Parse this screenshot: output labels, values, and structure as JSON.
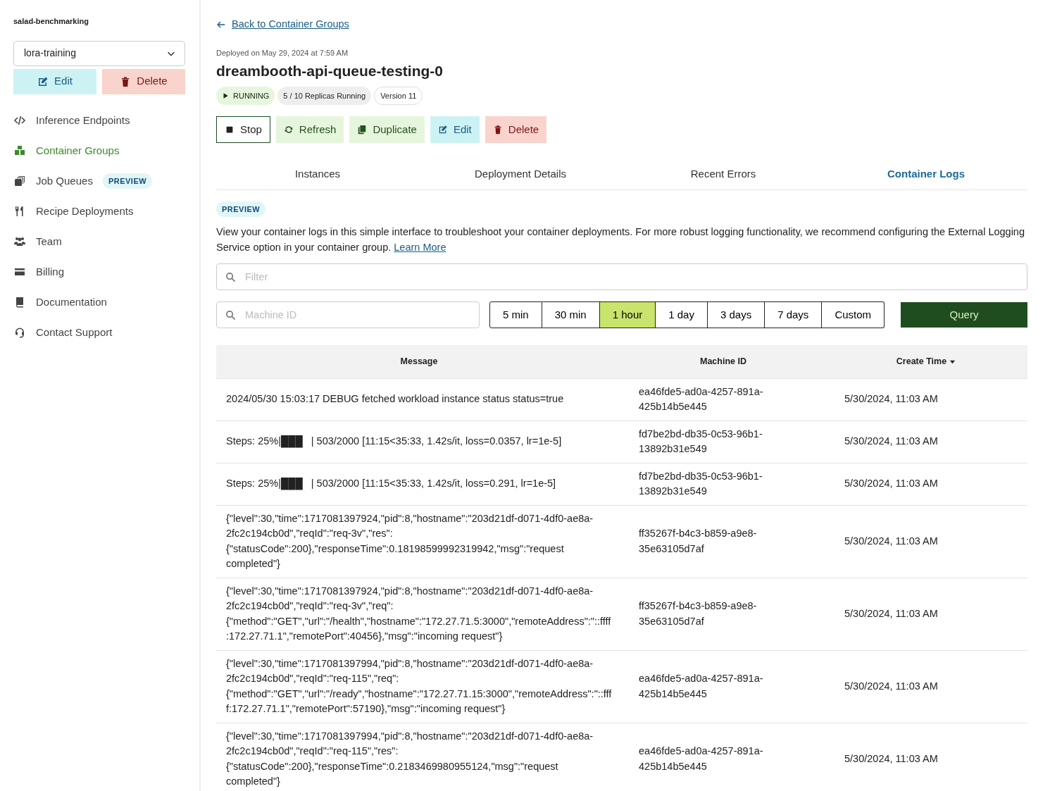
{
  "sidebar": {
    "org": "salad-benchmarking",
    "project_select": {
      "value": "lora-training"
    },
    "buttons": [
      {
        "label": "Edit",
        "kind": "edit"
      },
      {
        "label": "Delete",
        "kind": "delete"
      }
    ],
    "nav": [
      {
        "label": "Inference Endpoints",
        "kind": "code",
        "selected": false
      },
      {
        "label": "Container Groups",
        "kind": "containers",
        "selected": true
      },
      {
        "label": "Job Queues",
        "kind": "queue",
        "selected": false,
        "badge": "PREVIEW"
      },
      {
        "label": "Recipe Deployments",
        "kind": "recipe",
        "selected": false
      },
      {
        "label": "Team",
        "kind": "team",
        "selected": false
      },
      {
        "label": "Billing",
        "kind": "billing",
        "selected": false
      },
      {
        "label": "Documentation",
        "kind": "book",
        "selected": false
      },
      {
        "label": "Contact Support",
        "kind": "support",
        "selected": false
      }
    ]
  },
  "back_link": "Back to Container Groups",
  "deployed": "Deployed on May 29, 2024 at 7:59 AM",
  "title": "dreambooth-api-queue-testing-0",
  "badges": [
    {
      "label": "RUNNING",
      "kind": "status"
    },
    {
      "label": "5 / 10 Replicas Running",
      "kind": "replicas"
    },
    {
      "label": "Version 11",
      "kind": "version"
    }
  ],
  "actions": [
    {
      "label": "Stop",
      "kind": "stop"
    },
    {
      "label": "Refresh",
      "kind": "refresh"
    },
    {
      "label": "Duplicate",
      "kind": "duplicate"
    },
    {
      "label": "Edit",
      "kind": "edit"
    },
    {
      "label": "Delete",
      "kind": "delete"
    }
  ],
  "tabs": [
    {
      "label": "Instances",
      "selected": false
    },
    {
      "label": "Deployment Details",
      "selected": false
    },
    {
      "label": "Recent Errors",
      "selected": false
    },
    {
      "label": "Container Logs",
      "selected": true
    }
  ],
  "preview_badge": "PREVIEW",
  "description": {
    "text": "View your container logs in this simple interface to troubleshoot your container deployments. For more robust logging functionality, we recommend configuring the External Logging Service option in your container group.",
    "link": "Learn More"
  },
  "filter": {
    "placeholder": "Filter"
  },
  "machine_filter": {
    "placeholder": "Machine ID"
  },
  "ranges": [
    {
      "label": "5 min",
      "selected": false
    },
    {
      "label": "30 min",
      "selected": false
    },
    {
      "label": "1 hour",
      "selected": true
    },
    {
      "label": "1 day",
      "selected": false
    },
    {
      "label": "3 days",
      "selected": false
    },
    {
      "label": "7 days",
      "selected": false
    },
    {
      "label": "Custom",
      "selected": false
    }
  ],
  "query_button": "Query",
  "table": {
    "columns": [
      {
        "label": "Message",
        "sorted": false
      },
      {
        "label": "Machine ID",
        "sorted": false
      },
      {
        "label": "Create Time",
        "sorted": true
      }
    ],
    "rows": [
      {
        "message": "2024/05/30 15:03:17 DEBUG fetched workload instance status status=true",
        "machine_id": "ea46fde5-ad0a-4257-891a-425b14b5e445",
        "create_time": "5/30/2024, 11:03 AM"
      },
      {
        "message": "Steps: 25%|███   | 503/2000 [11:15<35:33, 1.42s/it, loss=0.0357, lr=1e-5]",
        "machine_id": "fd7be2bd-db35-0c53-96b1-13892b31e549",
        "create_time": "5/30/2024, 11:03 AM"
      },
      {
        "message": "Steps: 25%|███   | 503/2000 [11:15<35:33, 1.42s/it, loss=0.291, lr=1e-5]",
        "machine_id": "fd7be2bd-db35-0c53-96b1-13892b31e549",
        "create_time": "5/30/2024, 11:03 AM"
      },
      {
        "message": "{\"level\":30,\"time\":1717081397924,\"pid\":8,\"hostname\":\"203d21df-d071-4df0-ae8a-2fc2c194cb0d\",\"reqId\":\"req-3v\",\"res\":{\"statusCode\":200},\"responseTime\":0.18198599992319942,\"msg\":\"request completed\"}",
        "machine_id": "ff35267f-b4c3-b859-a9e8-35e63105d7af",
        "create_time": "5/30/2024, 11:03 AM"
      },
      {
        "message": "{\"level\":30,\"time\":1717081397924,\"pid\":8,\"hostname\":\"203d21df-d071-4df0-ae8a-2fc2c194cb0d\",\"reqId\":\"req-3v\",\"req\":{\"method\":\"GET\",\"url\":\"/health\",\"hostname\":\"172.27.71.5:3000\",\"remoteAddress\":\"::ffff:172.27.71.1\",\"remotePort\":40456},\"msg\":\"incoming request\"}",
        "machine_id": "ff35267f-b4c3-b859-a9e8-35e63105d7af",
        "create_time": "5/30/2024, 11:03 AM"
      },
      {
        "message": "{\"level\":30,\"time\":1717081397994,\"pid\":8,\"hostname\":\"203d21df-d071-4df0-ae8a-2fc2c194cb0d\",\"reqId\":\"req-115\",\"req\":{\"method\":\"GET\",\"url\":\"/ready\",\"hostname\":\"172.27.71.15:3000\",\"remoteAddress\":\"::ffff:172.27.71.1\",\"remotePort\":57190},\"msg\":\"incoming request\"}",
        "machine_id": "ea46fde5-ad0a-4257-891a-425b14b5e445",
        "create_time": "5/30/2024, 11:03 AM"
      },
      {
        "message": "{\"level\":30,\"time\":1717081397994,\"pid\":8,\"hostname\":\"203d21df-d071-4df0-ae8a-2fc2c194cb0d\",\"reqId\":\"req-115\",\"res\":{\"statusCode\":200},\"responseTime\":0.2183469980955124,\"msg\":\"request completed\"}",
        "machine_id": "ea46fde5-ad0a-4257-891a-425b14b5e445",
        "create_time": "5/30/2024, 11:03 AM"
      }
    ]
  }
}
